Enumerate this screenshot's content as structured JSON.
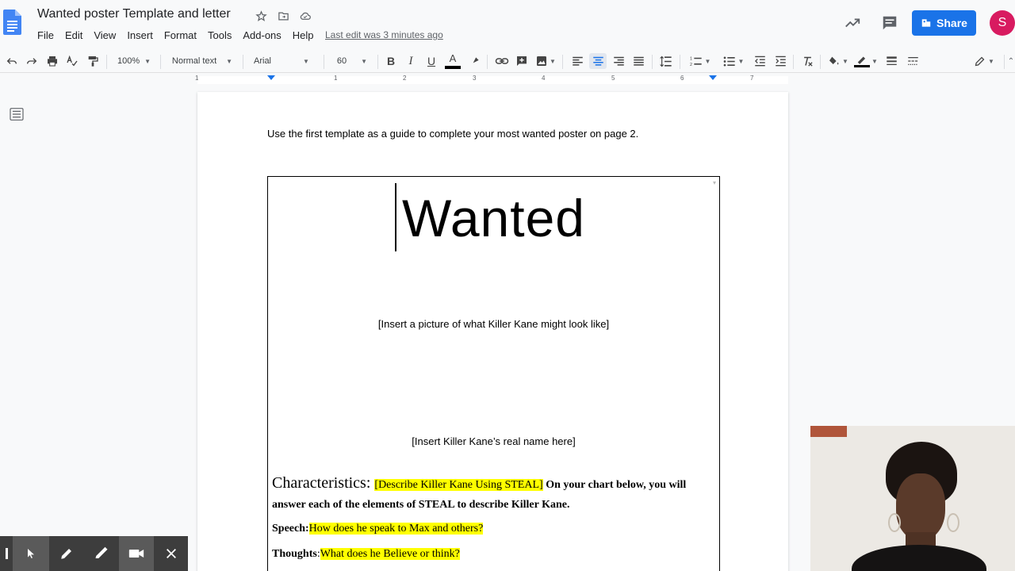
{
  "header": {
    "title": "Wanted poster Template and letter",
    "last_edit": "Last edit was 3 minutes ago",
    "share_label": "Share",
    "avatar_letter": "S",
    "menu": [
      "File",
      "Edit",
      "View",
      "Insert",
      "Format",
      "Tools",
      "Add-ons",
      "Help"
    ]
  },
  "toolbar": {
    "zoom": "100%",
    "style": "Normal text",
    "font": "Arial",
    "font_size": "60"
  },
  "ruler": {
    "numbers": [
      "1",
      "1",
      "2",
      "3",
      "4",
      "5",
      "6",
      "7"
    ]
  },
  "document": {
    "intro": "Use the first template as a guide to complete your most wanted poster on page 2.",
    "poster": {
      "heading": "Wanted",
      "picture_note": "[Insert a picture of what Killer Kane might look like]",
      "name_note": "[Insert Killer Kane’s real name here]",
      "characteristics_title": "Characteristics: ",
      "characteristics_highlight": "[Describe Killer Kane Using STEAL]",
      "characteristics_text": " On your chart below, you will answer each of the elements of STEAL to describe Killer Kane.",
      "speech_label": "Speech:",
      "speech_prompt": "How does he speak to Max and others?",
      "thoughts_label": "Thoughts",
      "thoughts_sep": ":",
      "thoughts_prompt": "What does he Believe or think?"
    }
  },
  "colors": {
    "share_blue": "#1a73e8",
    "avatar_pink": "#d81b60",
    "highlight": "#ffff00",
    "doc_blue": "#4285f4"
  },
  "icons": {
    "title": [
      "star-icon",
      "move-folder-icon",
      "cloud-saved-icon"
    ],
    "annotation_bar": [
      "pointer-icon",
      "pen-icon",
      "highlighter-icon",
      "camera-icon",
      "close-icon"
    ]
  }
}
